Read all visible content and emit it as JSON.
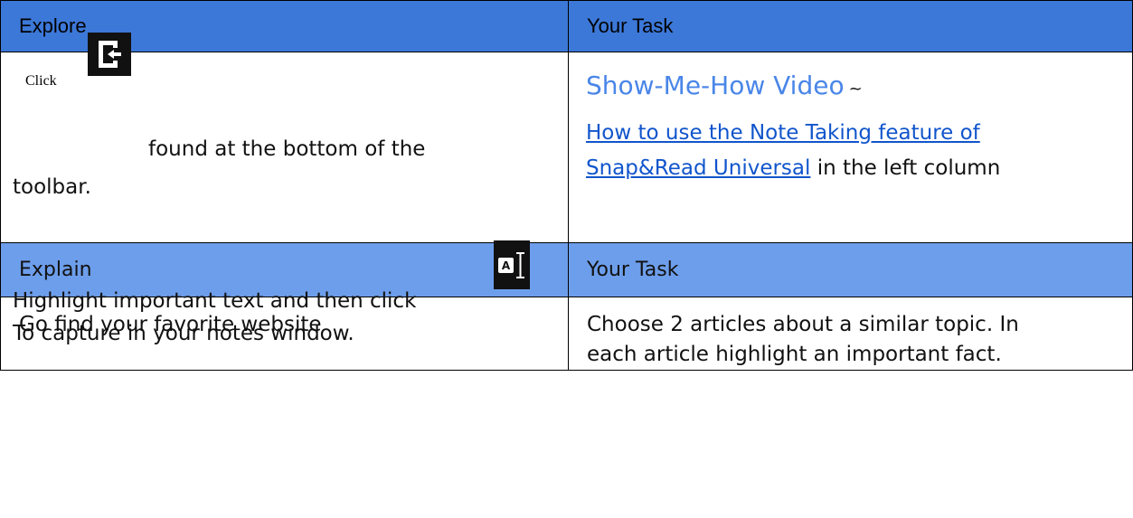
{
  "table": {
    "header1": {
      "left": "Explore",
      "right": "Your Task"
    },
    "row1": {
      "left": {
        "click_label": "Click",
        "found_text": "found at the bottom of the",
        "toolbar_text": "toolbar.",
        "highlight_text": "Highlight important text and then click",
        "capture_text": "To capture in your notes window.",
        "exit_icon": "exit-toolbar-icon",
        "capture_icon": "text-capture-icon"
      },
      "right": {
        "video_title": "Show-Me-How Video",
        "tilde": "~",
        "link_line1": "How to use the Note Taking feature of",
        "link_line2": "Snap&Read Universal",
        "after_link": " in the left column"
      }
    },
    "header2": {
      "left": "Explain",
      "right": "Your Task"
    },
    "row2": {
      "left": "Go find your favorite website",
      "right_line1": "Choose 2 articles about a similar topic.  In",
      "right_line2": "each article highlight an important fact."
    }
  },
  "colors": {
    "header1_bg": "#3c78d8",
    "header2_bg": "#6d9eeb",
    "video_title": "#4a86e8",
    "link": "#1155cc"
  }
}
